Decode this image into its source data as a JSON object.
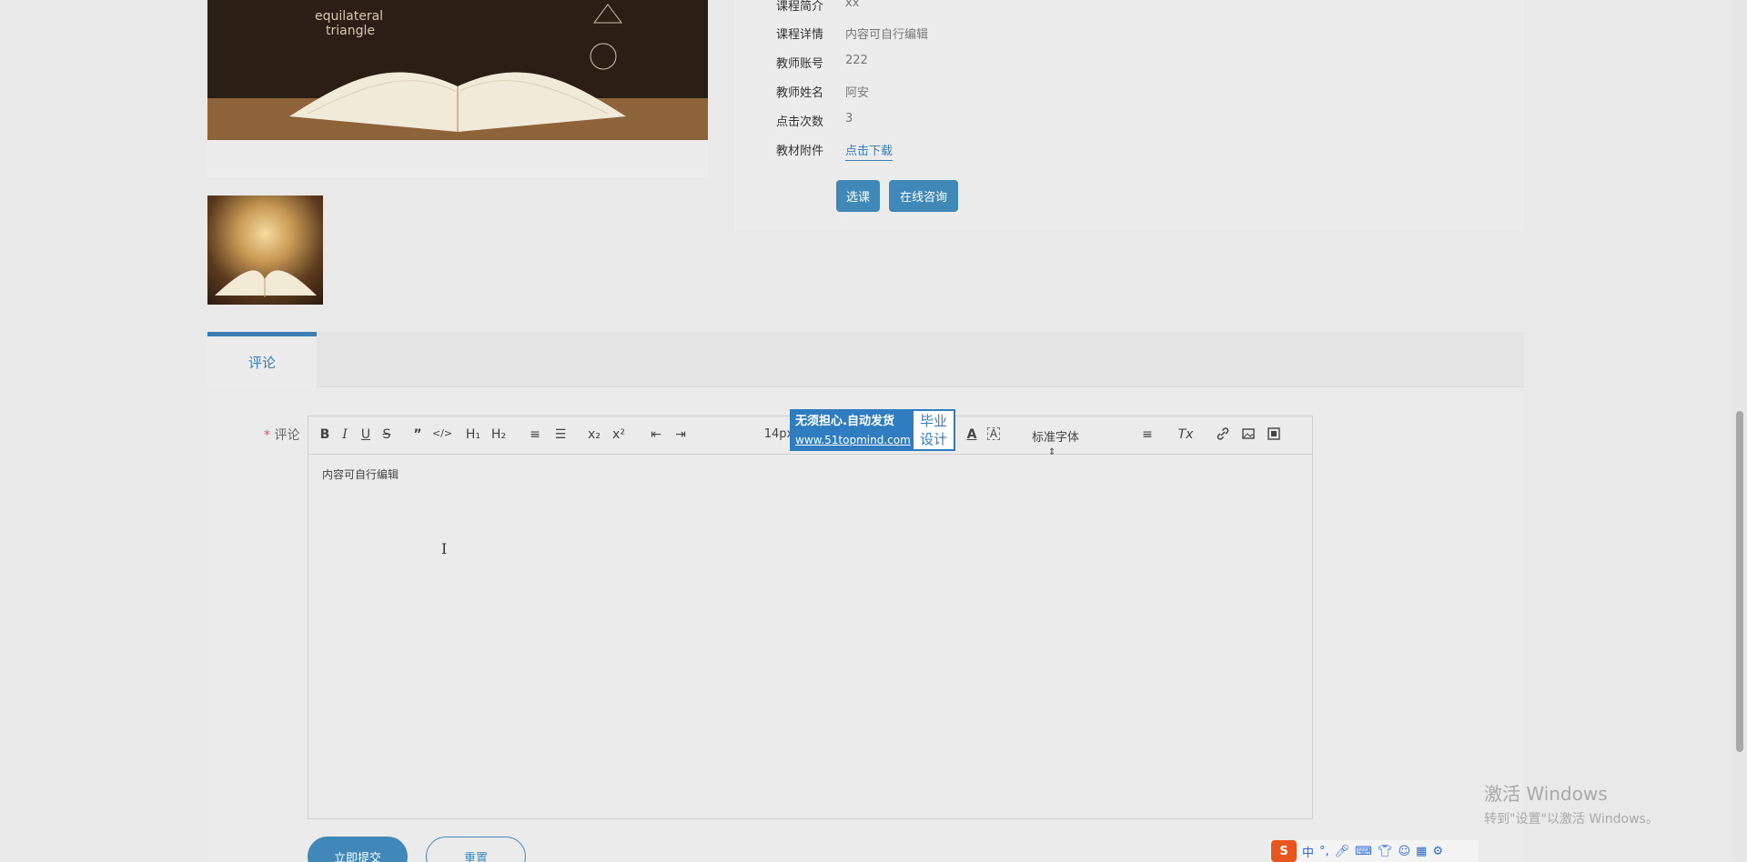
{
  "course_info": {
    "rows": [
      {
        "label": "课程简介",
        "value": "xx"
      },
      {
        "label": "课程详情",
        "value": "内容可自行编辑"
      },
      {
        "label": "教师账号",
        "value": "222"
      },
      {
        "label": "教师姓名",
        "value": "阿安"
      },
      {
        "label": "点击次数",
        "value": "3"
      },
      {
        "label": "教材附件",
        "value": "点击下载"
      }
    ],
    "select_button": "选课",
    "consult_button": "在线咨询"
  },
  "hero_image": {
    "text_line1": "equilateral",
    "text_line2": "triangle"
  },
  "tabs": [
    {
      "label": "评论"
    }
  ],
  "form": {
    "required_mark": "*",
    "label": "评论",
    "editor_content": "内容可自行编辑",
    "toolbar": {
      "bold": "B",
      "italic": "I",
      "underline": "U",
      "strike": "S",
      "quote": "”",
      "code": "</>",
      "h1": "H₁",
      "h2": "H₂",
      "ordered_list": "≡",
      "bullet_list": "☰",
      "sub": "x₂",
      "sup": "x²",
      "outdent": "⇤",
      "indent": "⇥",
      "font_size": "14px",
      "color": "A",
      "bg": "A",
      "font_family": "标准字体",
      "align": "≡",
      "clean": "Tx"
    },
    "submit_button": "立即提交",
    "reset_button": "重置"
  },
  "ad_banner": {
    "line1": "无须担心.自动发货",
    "line2": "www.51topmind.com",
    "right_line1": "毕业",
    "right_line2": "设计"
  },
  "watermark": {
    "title": "激活 Windows",
    "subtitle": "转到\"设置\"以激活 Windows。"
  },
  "ime": {
    "logo": "S",
    "lang": "中",
    "punct": "°,"
  },
  "colors": {
    "accent": "#3f88b7",
    "link": "#3a7fb3",
    "required": "#e24c4c",
    "ad": "#2f7dc0"
  }
}
